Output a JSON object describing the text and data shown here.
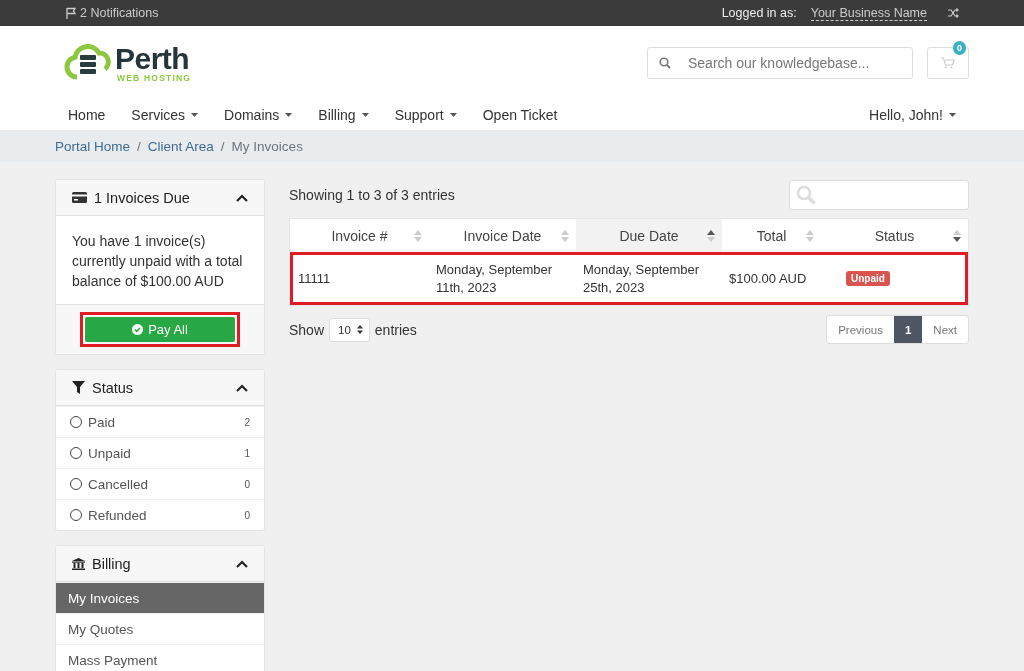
{
  "top_bar": {
    "notifications": "2 Notifications",
    "logged_in_label": "Logged in as:",
    "business_name": "Your Business Name"
  },
  "header": {
    "logo": {
      "name": "Perth",
      "tagline": "WEB HOSTING"
    },
    "search": {
      "placeholder": "Search our knowledgebase..."
    },
    "cart_count": "0"
  },
  "nav": {
    "items": [
      {
        "label": "Home",
        "dropdown": false
      },
      {
        "label": "Services",
        "dropdown": true
      },
      {
        "label": "Domains",
        "dropdown": true
      },
      {
        "label": "Billing",
        "dropdown": true
      },
      {
        "label": "Support",
        "dropdown": true
      },
      {
        "label": "Open Ticket",
        "dropdown": false
      }
    ],
    "user": "Hello, John!"
  },
  "breadcrumb": [
    {
      "label": "Portal Home",
      "current": false
    },
    {
      "separator": "/",
      "label": "Client Area",
      "current": false
    },
    {
      "separator": "/",
      "label": "My Invoices",
      "current": true
    }
  ],
  "invoices_due": {
    "title": "1 Invoices Due",
    "message": "You have 1 invoice(s) currently unpaid with a total balance of $100.00 AUD",
    "button": "Pay All",
    "highlighted": true
  },
  "status_panel": {
    "title": "Status",
    "items": [
      {
        "label": "Paid",
        "count": "2",
        "selected": false
      },
      {
        "label": "Unpaid",
        "count": "1",
        "selected": false
      },
      {
        "label": "Cancelled",
        "count": "0",
        "selected": false
      },
      {
        "label": "Refunded",
        "count": "0",
        "selected": false
      }
    ]
  },
  "billing_panel": {
    "title": "Billing",
    "items": [
      {
        "label": "My Invoices",
        "selected": true
      },
      {
        "label": "My Quotes",
        "selected": false
      },
      {
        "label": "Mass Payment",
        "selected": false
      }
    ]
  },
  "table": {
    "info": "Showing 1 to 3 of 3 entries",
    "columns": [
      {
        "label": "Invoice #",
        "sort_ascending": false,
        "sort_descending": false,
        "selected": false
      },
      {
        "label": "Invoice Date",
        "sort_ascending": false,
        "sort_descending": false,
        "selected": false
      },
      {
        "label": "Due Date",
        "sort_ascending": true,
        "sort_descending": false,
        "selected": true
      },
      {
        "label": "Total",
        "sort_ascending": false,
        "sort_descending": false,
        "selected": false
      },
      {
        "label": "Status",
        "sort_ascending": false,
        "sort_descending": true,
        "selected": false
      }
    ],
    "rows": [
      {
        "invoice": "11111",
        "invoice_date": "Monday, September 11th, 2023",
        "due_date": "Monday, September 25th, 2023",
        "total": "$100.00 AUD",
        "status": "Unpaid",
        "highlighted": true
      }
    ],
    "show_label": "Show",
    "page_size": "10",
    "entries_label": "entries",
    "pagination": [
      {
        "label": "Previous",
        "kind": "nav",
        "selected": false
      },
      {
        "label": "1",
        "kind": "page",
        "selected": true
      },
      {
        "label": "Next",
        "kind": "nav",
        "selected": false
      }
    ]
  }
}
